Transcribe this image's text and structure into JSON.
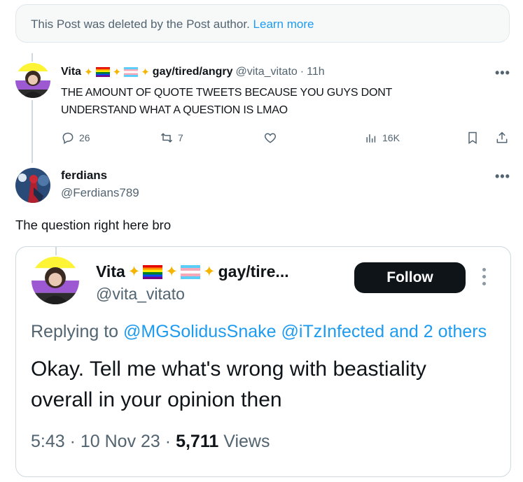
{
  "deleted_notice": {
    "text": "This Post was deleted by the Post author.",
    "link": "Learn more"
  },
  "reply_tweet": {
    "name": "Vita",
    "name_suffix": "gay/tired/angry",
    "handle": "@vita_vitato",
    "time": "11h",
    "text_line1": "THE AMOUNT OF QUOTE TWEETS BECAUSE YOU GUYS DONT",
    "text_line2": "UNDERSTAND WHAT A QUESTION IS LMAO",
    "replies": "26",
    "reposts": "7",
    "views": "16K",
    "more": "•••"
  },
  "main_tweet": {
    "name": "ferdians",
    "handle": "@Ferdians789",
    "text": "The question right here bro",
    "more": "•••"
  },
  "quoted": {
    "name": "Vita",
    "name_suffix": "gay/tire...",
    "handle": "@vita_vitato",
    "follow_label": "Follow",
    "replying_prefix": "Replying to",
    "replying_to": "@MGSolidusSnake @iTzInfected and 2 others",
    "text_line1": "Okay. Tell me what's wrong with beastiality",
    "text_line2": "overall in your opinion then",
    "time": "5:43 · 10 Nov 23 ·",
    "views_count": "5,711",
    "views_label": "Views"
  },
  "colors": {
    "accent": "#1d9bf0",
    "text": "#0f1419",
    "muted": "#536471",
    "border": "#cfd9de"
  }
}
